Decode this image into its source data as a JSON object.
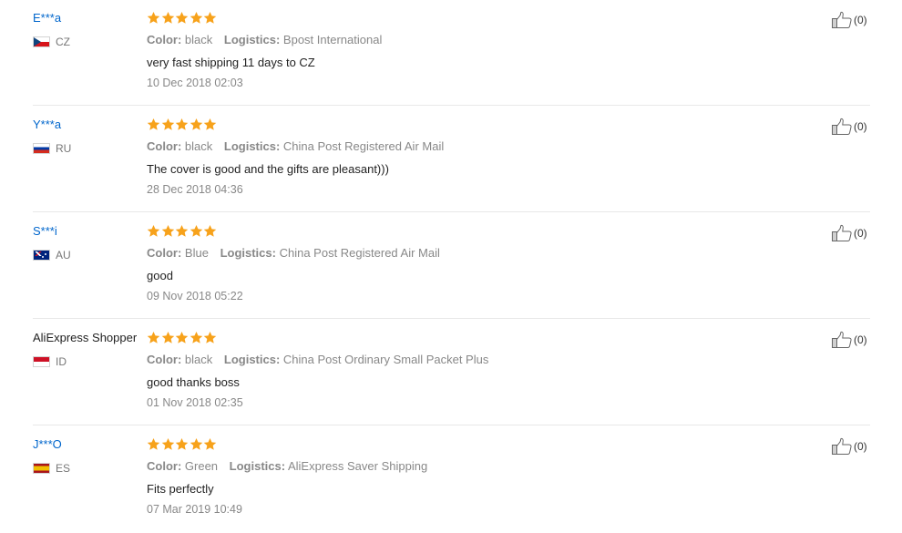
{
  "reviews": [
    {
      "user": "E***a",
      "country_code": "CZ",
      "flag_icon": "czech-flag-icon",
      "rating": 5,
      "color_label": "Color:",
      "color": "black",
      "logistics_label": "Logistics:",
      "logistics": "Bpost International",
      "comment": "very fast shipping 11 days to CZ",
      "date": "10 Dec 2018 02:03",
      "helpful": "(0)"
    },
    {
      "user": "Y***a",
      "country_code": "RU",
      "flag_icon": "russia-flag-icon",
      "rating": 5,
      "color_label": "Color:",
      "color": "black",
      "logistics_label": "Logistics:",
      "logistics": "China Post Registered Air Mail",
      "comment": "The cover is good and the gifts are pleasant)))",
      "date": "28 Dec 2018 04:36",
      "helpful": "(0)"
    },
    {
      "user": "S***i",
      "country_code": "AU",
      "flag_icon": "australia-flag-icon",
      "rating": 5,
      "color_label": "Color:",
      "color": "Blue",
      "logistics_label": "Logistics:",
      "logistics": "China Post Registered Air Mail",
      "comment": "good",
      "date": "09 Nov 2018 05:22",
      "helpful": "(0)"
    },
    {
      "user": "AliExpress Shopper",
      "country_code": "ID",
      "flag_icon": "indonesia-flag-icon",
      "rating": 5,
      "color_label": "Color:",
      "color": "black",
      "logistics_label": "Logistics:",
      "logistics": "China Post Ordinary Small Packet Plus",
      "comment": "good thanks boss",
      "date": "01 Nov 2018 02:35",
      "helpful": "(0)"
    },
    {
      "user": "J***O",
      "country_code": "ES",
      "flag_icon": "spain-flag-icon",
      "rating": 5,
      "color_label": "Color:",
      "color": "Green",
      "logistics_label": "Logistics:",
      "logistics": "AliExpress Saver Shipping",
      "comment": "Fits perfectly",
      "date": "07 Mar 2019 10:49",
      "helpful": "(0)"
    }
  ],
  "colors": {
    "star": "#f7a21b",
    "username_link": "#0066cc",
    "muted_text": "#888888"
  }
}
